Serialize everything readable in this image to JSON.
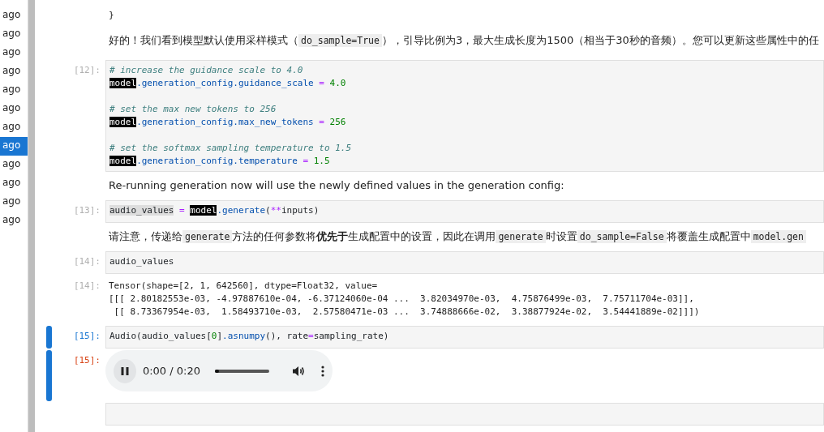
{
  "sidebar": {
    "items": [
      {
        "label": "ago",
        "selected": false
      },
      {
        "label": "ago",
        "selected": false
      },
      {
        "label": "ago",
        "selected": false
      },
      {
        "label": "ago",
        "selected": false
      },
      {
        "label": "ago",
        "selected": false
      },
      {
        "label": "ago",
        "selected": false
      },
      {
        "label": "ago",
        "selected": false
      },
      {
        "label": "ago",
        "selected": true
      },
      {
        "label": "ago",
        "selected": false
      },
      {
        "label": "ago",
        "selected": false
      },
      {
        "label": "ago",
        "selected": false
      },
      {
        "label": "ago",
        "selected": false
      }
    ]
  },
  "cells": [
    {
      "kind": "output_text",
      "active": false,
      "lines": [
        "}"
      ]
    },
    {
      "kind": "markdown",
      "active": false,
      "segments": [
        {
          "kind": "text",
          "text": "好的！我们看到模型默认使用采样模式（"
        },
        {
          "kind": "code",
          "text": "do_sample=True"
        },
        {
          "kind": "text",
          "text": "），引导比例为3，最大生成长度为1500（相当于30秒的音频）。您可以更新这些属性中的任"
        }
      ]
    },
    {
      "kind": "code",
      "prompt": "[12]:",
      "active": false,
      "lines": [
        {
          "kind": "code",
          "segments": [
            {
              "kind": "comment",
              "text": "# increase the guidance scale to 4.0"
            }
          ]
        },
        {
          "kind": "code",
          "segments": [
            {
              "kind": "highlight",
              "text": "model"
            },
            {
              "kind": "attr",
              "text": ".generation_config.guidance_scale"
            },
            {
              "kind": "op",
              "text": " = "
            },
            {
              "kind": "number",
              "text": "4.0"
            }
          ]
        },
        {
          "kind": "blank"
        },
        {
          "kind": "code",
          "segments": [
            {
              "kind": "comment",
              "text": "# set the max new tokens to 256"
            }
          ]
        },
        {
          "kind": "code",
          "segments": [
            {
              "kind": "highlight",
              "text": "model"
            },
            {
              "kind": "attr",
              "text": ".generation_config.max_new_tokens"
            },
            {
              "kind": "op",
              "text": " = "
            },
            {
              "kind": "number",
              "text": "256"
            }
          ]
        },
        {
          "kind": "blank"
        },
        {
          "kind": "code",
          "segments": [
            {
              "kind": "comment",
              "text": "# set the softmax sampling temperature to 1.5"
            }
          ]
        },
        {
          "kind": "code",
          "segments": [
            {
              "kind": "highlight",
              "text": "model"
            },
            {
              "kind": "attr",
              "text": ".generation_config.temperature"
            },
            {
              "kind": "op",
              "text": " = "
            },
            {
              "kind": "number",
              "text": "1.5"
            }
          ]
        }
      ]
    },
    {
      "kind": "markdown",
      "active": false,
      "segments": [
        {
          "kind": "text",
          "text": "Re-running generation now will use the newly defined values in the generation config:"
        }
      ]
    },
    {
      "kind": "code",
      "prompt": "[13]:",
      "active": false,
      "lines": [
        {
          "kind": "code",
          "segments": [
            {
              "kind": "selection",
              "text": "audio_values"
            },
            {
              "kind": "op",
              "text": " = "
            },
            {
              "kind": "highlight",
              "text": "model"
            },
            {
              "kind": "attr",
              "text": ".generate"
            },
            {
              "kind": "plain",
              "text": "("
            },
            {
              "kind": "op",
              "text": "**"
            },
            {
              "kind": "plain",
              "text": "inputs)"
            }
          ]
        }
      ]
    },
    {
      "kind": "markdown",
      "active": false,
      "segments": [
        {
          "kind": "text",
          "text": "请注意，传递给"
        },
        {
          "kind": "code",
          "text": "generate"
        },
        {
          "kind": "text",
          "text": "方法的任何参数将"
        },
        {
          "kind": "bold",
          "text": "优先于"
        },
        {
          "kind": "text",
          "text": "生成配置中的设置，因此在调用"
        },
        {
          "kind": "code",
          "text": "generate"
        },
        {
          "kind": "text",
          "text": "时设置"
        },
        {
          "kind": "code",
          "text": "do_sample=False"
        },
        {
          "kind": "text",
          "text": "将覆盖生成配置中"
        },
        {
          "kind": "code",
          "text": "model.gen"
        }
      ]
    },
    {
      "kind": "code",
      "prompt": "[14]:",
      "active": false,
      "lines": [
        {
          "kind": "code",
          "segments": [
            {
              "kind": "plain",
              "text": "audio_values"
            }
          ]
        }
      ]
    },
    {
      "kind": "output_text",
      "prompt": "[14]:",
      "active": false,
      "lines": [
        "Tensor(shape=[2, 1, 642560], dtype=Float32, value=",
        "[[[ 2.80182553e-03, -4.97887610e-04, -6.37124060e-04 ...  3.82034970e-03,  4.75876499e-03,  7.75711704e-03]],",
        " [[ 8.73367954e-03,  1.58493710e-03,  2.57580471e-03 ...  3.74888666e-02,  3.38877924e-02,  3.54441889e-02]]])"
      ]
    },
    {
      "kind": "code",
      "prompt": "[15]:",
      "active": true,
      "lines": [
        {
          "kind": "code",
          "segments": [
            {
              "kind": "plain",
              "text": "Audio(audio_values["
            },
            {
              "kind": "number",
              "text": "0"
            },
            {
              "kind": "plain",
              "text": "]"
            },
            {
              "kind": "attr",
              "text": ".asnumpy"
            },
            {
              "kind": "plain",
              "text": "(), rate"
            },
            {
              "kind": "op",
              "text": "="
            },
            {
              "kind": "plain",
              "text": "sampling_rate)"
            }
          ]
        }
      ]
    },
    {
      "kind": "audio",
      "prompt": "[15]:",
      "active": true,
      "time": "0:00 / 0:20",
      "level": 0.07,
      "playing": true
    },
    {
      "kind": "code",
      "active": false
    }
  ]
}
